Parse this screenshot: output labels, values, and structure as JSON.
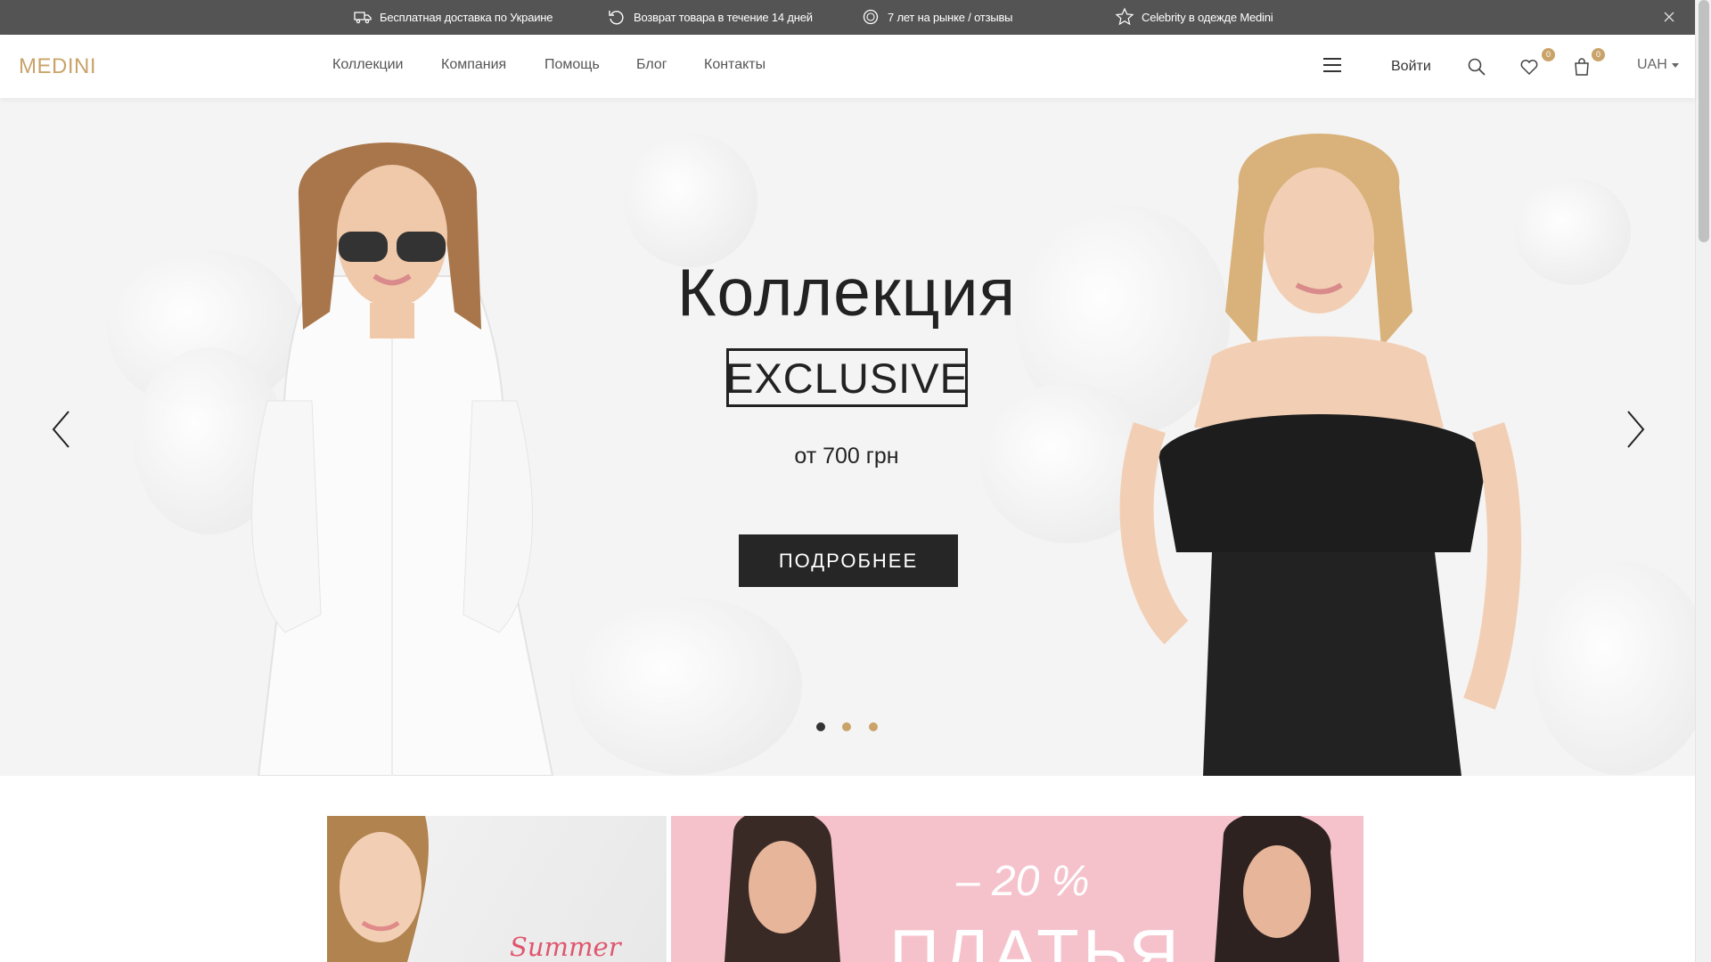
{
  "topbar": {
    "items": [
      {
        "icon": "delivery-truck-icon",
        "text": "Бесплатная доставка по Украине"
      },
      {
        "icon": "return-arrow-icon",
        "text": "Возврат товара в течение 14 дней"
      },
      {
        "icon": "reviews-badge-icon",
        "text": "7 лет на рынке / отзывы"
      },
      {
        "icon": "star-icon",
        "text": "Celebrity в одежде Medini"
      }
    ],
    "close_icon": "close-icon"
  },
  "header": {
    "logo": "MEDINI",
    "nav": [
      "Коллекции",
      "Компания",
      "Помощь",
      "Блог",
      "Контакты"
    ],
    "login_label": "Войти",
    "wishlist_count": "0",
    "cart_count": "0",
    "currency": "UAH"
  },
  "hero": {
    "title": "Коллекция",
    "badge": "EXCLUSIVE",
    "price": "от 700 грн",
    "button": "ПОДРОБНЕЕ",
    "slides_total": 3,
    "active_slide": 1
  },
  "banners": {
    "left_text": "Summer",
    "right_discount": "– 20 %",
    "right_title": "ПЛАТЬЯ"
  },
  "colors": {
    "accent": "#c9a36a",
    "topbar_bg": "#545454",
    "button_bg": "#262626",
    "banner_pink": "#f5c2cc"
  }
}
